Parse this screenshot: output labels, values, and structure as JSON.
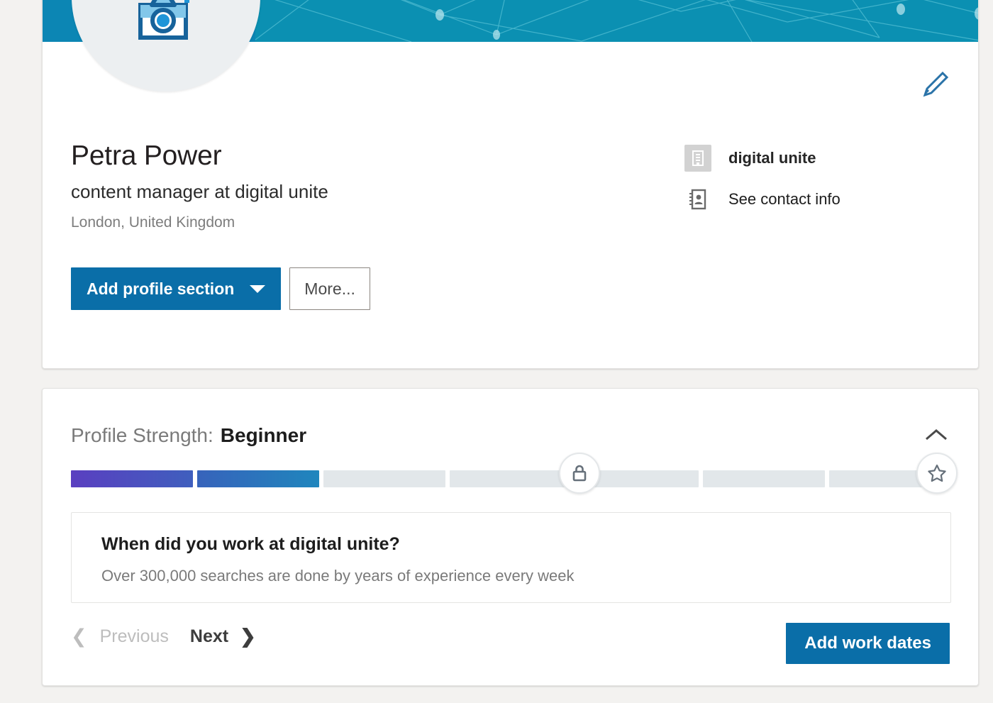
{
  "profile": {
    "name": "Petra Power",
    "headline": "content manager at digital unite",
    "location": "London, United Kingdom",
    "avatar_icon": "camera-add-icon",
    "edit_icon": "pencil-edit-icon",
    "banner_color": "#0b90b2",
    "buttons": {
      "add_section": "Add profile section",
      "add_section_caret": "chevron-down-icon",
      "more": "More..."
    },
    "meta": [
      {
        "icon": "company-building-icon",
        "label": "digital unite"
      },
      {
        "icon": "contact-card-icon",
        "label": "See contact info"
      }
    ]
  },
  "strength": {
    "label": "Profile Strength:",
    "level": "Beginner",
    "collapse_icon": "chevron-up-icon",
    "progress": {
      "total_segments": 7,
      "filled_segments": 2,
      "fill_colors": [
        "#5a3fc0",
        "#3f5fbe",
        "#1f86bd"
      ],
      "empty_color": "#e2e7ea"
    },
    "markers": [
      {
        "icon": "lock-icon",
        "name": "all-star-lock-marker"
      },
      {
        "icon": "star-icon",
        "name": "all-star-marker"
      }
    ],
    "question": {
      "title": "When did you work at digital unite?",
      "subtitle": "Over 300,000 searches are done by years of experience every week"
    },
    "nav": {
      "previous": "Previous",
      "next": "Next",
      "prev_icon": "chevron-left-icon",
      "next_icon": "chevron-right-icon"
    },
    "cta": "Add work dates"
  }
}
